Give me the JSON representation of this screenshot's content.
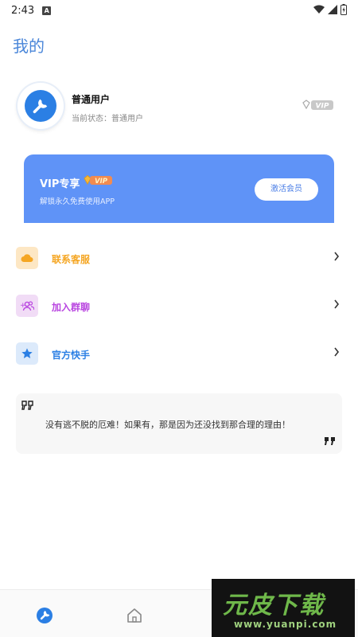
{
  "status_bar": {
    "time": "2:43",
    "notification_icon": "a-icon"
  },
  "page": {
    "title": "我的"
  },
  "profile": {
    "name": "普通用户",
    "status": "当前状态：普通用户",
    "badge": "VIP"
  },
  "vip_card": {
    "title": "VIP专享",
    "badge": "VIP",
    "subtitle": "解锁永久免费使用APP",
    "button_label": "激活会员",
    "background_color": "#5f93f7"
  },
  "menu": [
    {
      "label": "联系客服",
      "icon": "cloud-icon",
      "color": "#f5a623"
    },
    {
      "label": "加入群聊",
      "icon": "group-icon",
      "color": "#b946e0"
    },
    {
      "label": "官方快手",
      "icon": "star-icon",
      "color": "#2b7fe4"
    }
  ],
  "quote": {
    "text": "没有逃不脱的厄难！如果有，那是因为还没找到那合理的理由！"
  },
  "bottom_nav": [
    {
      "icon": "wrench-icon",
      "active": true
    },
    {
      "icon": "home-icon",
      "active": false
    }
  ],
  "watermark": {
    "brand": "元皮下载",
    "url": "www.yuanpi.com"
  }
}
